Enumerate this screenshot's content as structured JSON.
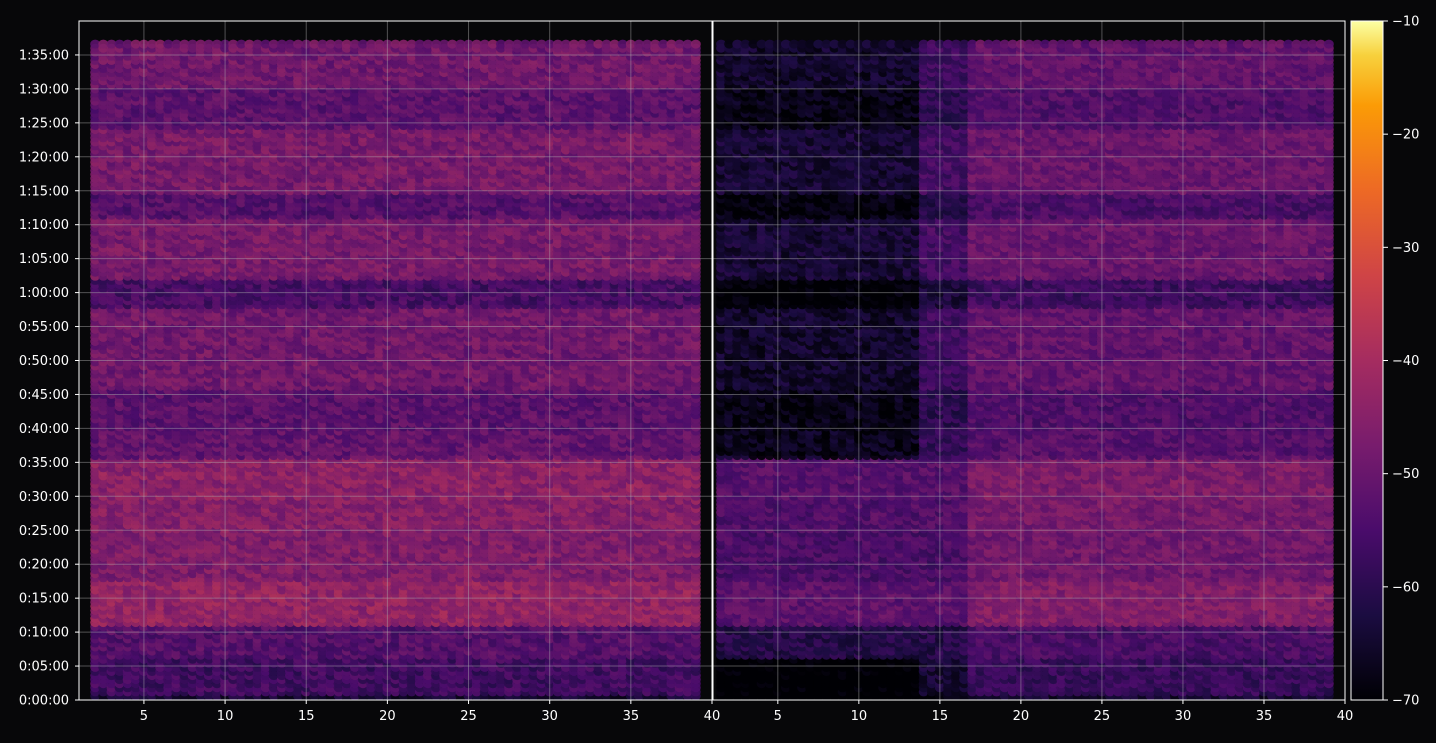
{
  "chart_data": {
    "type": "heatmap",
    "title": "",
    "xlabel": "",
    "ylabel": "",
    "colormap": "inferno",
    "background": "#070709",
    "grid": true,
    "shared_y": true,
    "y_ticks": [
      "0:00:00",
      "0:05:00",
      "0:10:00",
      "0:15:00",
      "0:20:00",
      "0:25:00",
      "0:30:00",
      "0:35:00",
      "0:40:00",
      "0:45:00",
      "0:50:00",
      "0:55:00",
      "1:00:00",
      "1:05:00",
      "1:10:00",
      "1:15:00",
      "1:20:00",
      "1:25:00",
      "1:30:00",
      "1:35:00"
    ],
    "ylim_minutes": [
      0,
      100
    ],
    "panels": [
      {
        "xlim": [
          1,
          40
        ],
        "x_ticks": [
          5,
          10,
          15,
          20,
          25,
          30,
          35,
          40
        ],
        "x_tick_labels": [
          "5",
          "10",
          "15",
          "20",
          "25",
          "30",
          "35",
          "40"
        ],
        "x_min_data": 2,
        "x_max_data": 39,
        "brightness": 1.0
      },
      {
        "xlim": [
          1,
          40
        ],
        "x_ticks": [
          5,
          10,
          15,
          20,
          25,
          30,
          35,
          40
        ],
        "x_tick_labels": [
          "5",
          "10",
          "15",
          "20",
          "25",
          "30",
          "35",
          "40"
        ],
        "x_min_data": 1.5,
        "x_max_data": 39,
        "brightness": 0.9
      }
    ],
    "colorbar": {
      "min": -70,
      "max": -10,
      "ticks": [
        -70,
        -60,
        -50,
        -40,
        -30,
        -20,
        -10
      ],
      "tick_labels": [
        "−70",
        "−60",
        "−50",
        "−40",
        "−30",
        "−20",
        "−10"
      ]
    },
    "y_bands": [
      {
        "from": 1,
        "to": 6,
        "value": -58
      },
      {
        "from": 6,
        "to": 11,
        "value": -55
      },
      {
        "from": 11,
        "to": 18,
        "value": -46
      },
      {
        "from": 18,
        "to": 25,
        "value": -49
      },
      {
        "from": 25,
        "to": 30,
        "value": -48
      },
      {
        "from": 30,
        "to": 35.5,
        "value": -47
      },
      {
        "from": 35.5,
        "to": 40,
        "value": -53
      },
      {
        "from": 40,
        "to": 46,
        "value": -54
      },
      {
        "from": 46,
        "to": 58,
        "value": -51
      },
      {
        "from": 58,
        "to": 62,
        "value": -57
      },
      {
        "from": 62,
        "to": 71,
        "value": -50
      },
      {
        "from": 71,
        "to": 75,
        "value": -55
      },
      {
        "from": 75,
        "to": 84,
        "value": -50
      },
      {
        "from": 84,
        "to": 90,
        "value": -54
      },
      {
        "from": 90,
        "to": 97,
        "value": -51
      }
    ]
  }
}
